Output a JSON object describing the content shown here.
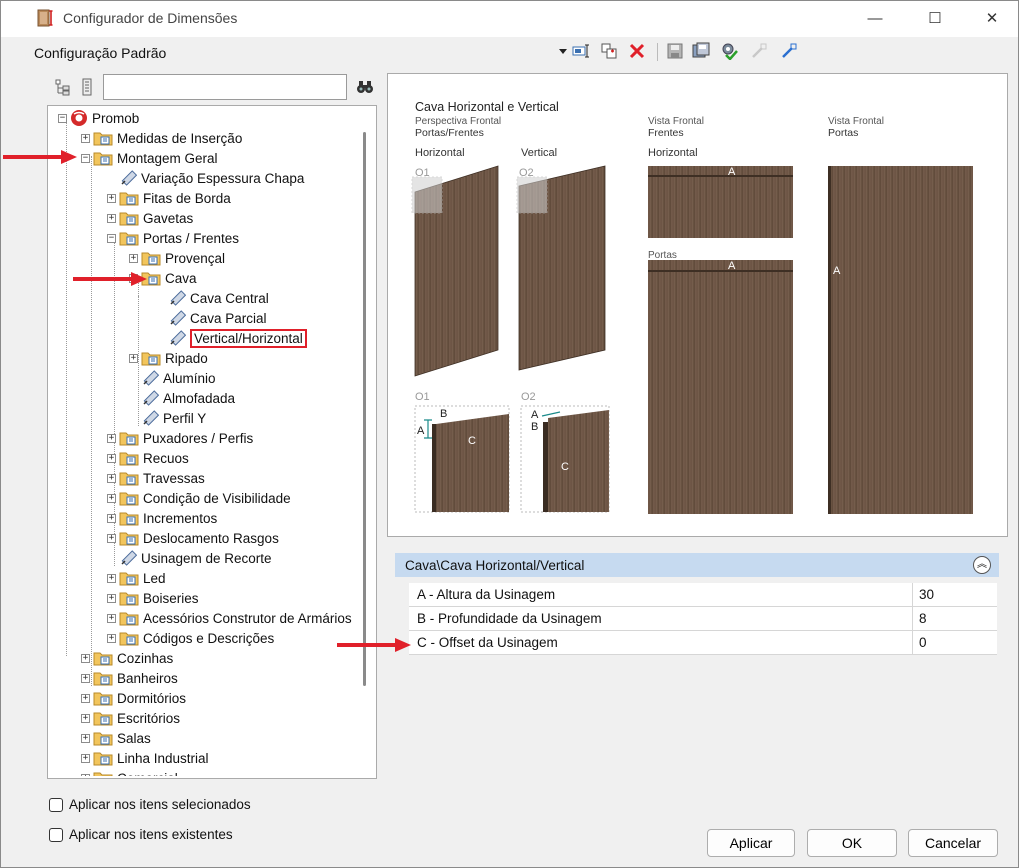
{
  "window": {
    "title": "Configurador de Dimensões",
    "minimize": "—",
    "maximize": "☐",
    "close": "✕"
  },
  "toolbar": {
    "config_label": "Configuração Padrão",
    "icons": [
      "dropdown-icon",
      "rename-icon",
      "copy-config-icon",
      "delete-icon",
      "save-icon",
      "save-as-icon",
      "settings-icon",
      "export-icon",
      "import-icon"
    ]
  },
  "search": {
    "placeholder": ""
  },
  "tree": {
    "nodes": [
      {
        "label": "Promob"
      },
      {
        "label": "Medidas de Inserção"
      },
      {
        "label": "Montagem Geral"
      },
      {
        "label": "Variação Espessura Chapa"
      },
      {
        "label": "Fitas de Borda"
      },
      {
        "label": "Gavetas"
      },
      {
        "label": "Portas / Frentes"
      },
      {
        "label": "Provençal"
      },
      {
        "label": "Cava"
      },
      {
        "label": "Cava Central"
      },
      {
        "label": "Cava Parcial"
      },
      {
        "label": "Vertical/Horizontal"
      },
      {
        "label": "Ripado"
      },
      {
        "label": "Alumínio"
      },
      {
        "label": "Almofadada"
      },
      {
        "label": "Perfil Y"
      },
      {
        "label": "Puxadores / Perfis"
      },
      {
        "label": "Recuos"
      },
      {
        "label": "Travessas"
      },
      {
        "label": "Condição de Visibilidade"
      },
      {
        "label": "Incrementos"
      },
      {
        "label": "Deslocamento Rasgos"
      },
      {
        "label": "Usinagem de Recorte"
      },
      {
        "label": "Led"
      },
      {
        "label": "Boiseries"
      },
      {
        "label": "Acessórios Construtor de Armários"
      },
      {
        "label": "Códigos e Descrições"
      },
      {
        "label": "Cozinhas"
      },
      {
        "label": "Banheiros"
      },
      {
        "label": "Dormitórios"
      },
      {
        "label": "Escritórios"
      },
      {
        "label": "Salas"
      },
      {
        "label": "Linha Industrial"
      },
      {
        "label": "Comercial"
      }
    ]
  },
  "preview": {
    "title": "Cava Horizontal e Vertical",
    "sub1": "Perspectiva Frontal",
    "sub2": "Portas/Frentes",
    "col_h": "Horizontal",
    "col_v": "Vertical",
    "vf1_title": "Vista Frontal",
    "vf1_sub": "Frentes",
    "vf1_h": "Horizontal",
    "vf2_title": "Vista Frontal",
    "vf2_sub": "Portas",
    "portas_label": "Portas",
    "o1": "O1",
    "o2": "O2",
    "a": "A",
    "b": "B",
    "c": "C"
  },
  "properties": {
    "header": "Cava\\Cava Horizontal/Vertical",
    "rows": [
      {
        "label": "A - Altura da Usinagem",
        "value": "30"
      },
      {
        "label": "B - Profundidade da Usinagem",
        "value": "8"
      },
      {
        "label": "C - Offset da Usinagem",
        "value": "0"
      }
    ]
  },
  "checkboxes": {
    "selected": "Aplicar nos itens selecionados",
    "existing": "Aplicar nos itens existentes"
  },
  "buttons": {
    "apply": "Aplicar",
    "ok": "OK",
    "cancel": "Cancelar"
  },
  "colors": {
    "wood": "#6b5443",
    "accent_red": "#e0202a",
    "header_blue": "#c6daf0"
  }
}
